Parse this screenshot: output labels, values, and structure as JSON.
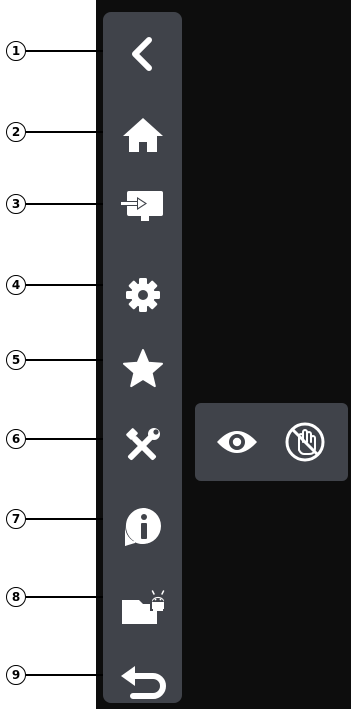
{
  "callouts": [
    "1",
    "2",
    "3",
    "4",
    "5",
    "6",
    "7",
    "8",
    "9"
  ],
  "sidebar": {
    "items": [
      {
        "icon": "chevron-left-icon"
      },
      {
        "icon": "home-icon"
      },
      {
        "icon": "input-source-icon"
      },
      {
        "icon": "gear-icon"
      },
      {
        "icon": "star-icon"
      },
      {
        "icon": "tools-icon"
      },
      {
        "icon": "info-icon"
      },
      {
        "icon": "android-folder-icon"
      },
      {
        "icon": "return-icon"
      }
    ]
  },
  "sub_panel": {
    "items": [
      {
        "icon": "eye-icon"
      },
      {
        "icon": "touch-disabled-icon"
      }
    ]
  },
  "colors": {
    "panel": "#40434a",
    "icon": "#ffffff",
    "background": "#0d0d0d"
  }
}
